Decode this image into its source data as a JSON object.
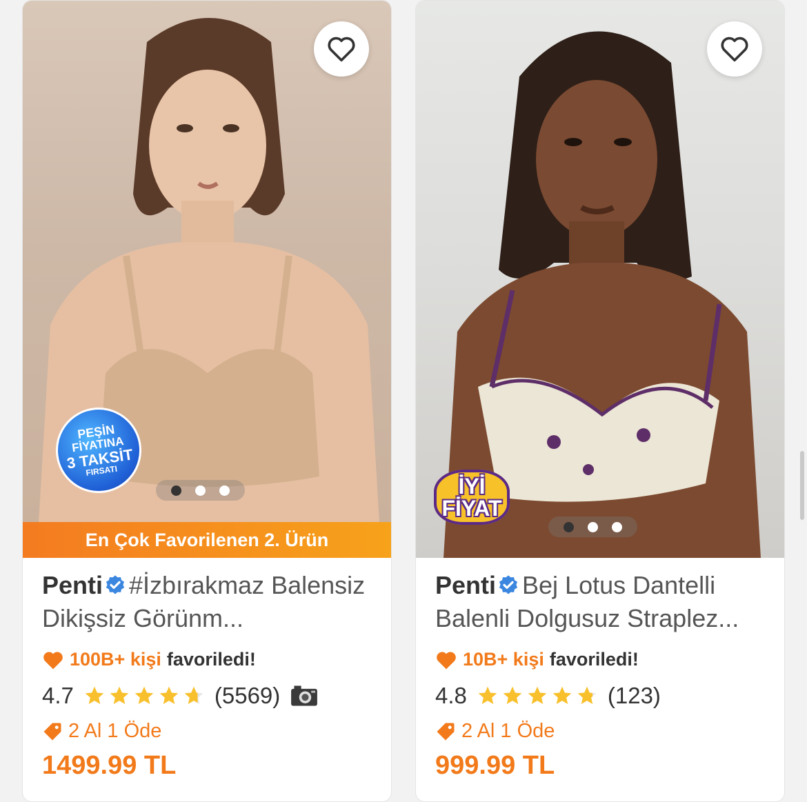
{
  "products": [
    {
      "brand": "Penti",
      "title": "#İzbırakmaz Balensiz Dikişsiz Görünm...",
      "banner": "En Çok Favorilenen 2. Ürün",
      "badge": {
        "type": "pesin",
        "lines": [
          "PEŞİN",
          "FİYATINA",
          "3 TAKSİT",
          "FIRSATI"
        ]
      },
      "favorites": {
        "count": "100B+ kişi",
        "suffix": "favoriledi!"
      },
      "rating": "4.7",
      "stars": 4.7,
      "reviews": "(5569)",
      "has_photo_reviews": true,
      "promo": "2 Al 1 Öde",
      "price": "1499.99 TL",
      "image_dots": 3,
      "active_dot": 0
    },
    {
      "brand": "Penti",
      "title": "Bej Lotus Dantelli Balenli Dolgusuz Straplez...",
      "banner": "",
      "badge": {
        "type": "iyi",
        "lines": [
          "İYİ",
          "FİYAT"
        ]
      },
      "favorites": {
        "count": "10B+ kişi",
        "suffix": "favoriledi!"
      },
      "rating": "4.8",
      "stars": 4.8,
      "reviews": "(123)",
      "has_photo_reviews": false,
      "promo": "2 Al 1 Öde",
      "price": "999.99 TL",
      "image_dots": 3,
      "active_dot": 0
    }
  ],
  "colors": {
    "accent": "#f27a1a",
    "star": "#f8c02c",
    "verified": "#3b87e0"
  }
}
